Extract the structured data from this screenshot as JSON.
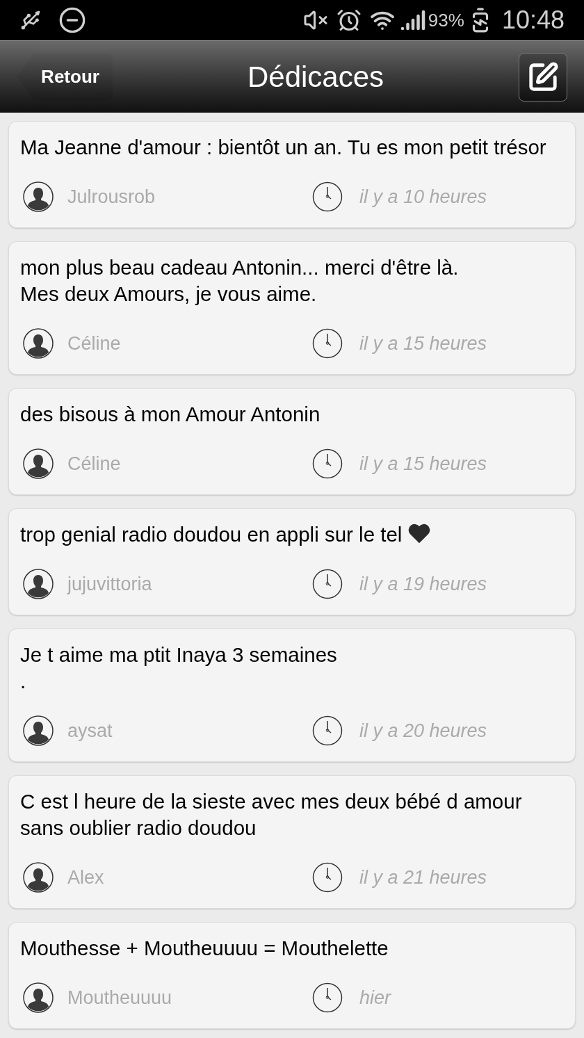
{
  "status_bar": {
    "battery": "93%",
    "time": "10:48"
  },
  "header": {
    "back": "Retour",
    "title": "Dédicaces"
  },
  "messages": [
    {
      "text": "Ma Jeanne d'amour : bientôt un an. Tu es mon petit trésor",
      "heart": false,
      "author": "Julrousrob",
      "time": "il y a 10 heures"
    },
    {
      "text": "mon plus beau cadeau Antonin... merci d'être là.\nMes deux Amours, je vous aime.",
      "heart": false,
      "author": "Céline",
      "time": "il y a 15 heures"
    },
    {
      "text": "des bisous à mon Amour Antonin",
      "heart": false,
      "author": "Céline",
      "time": "il y a 15 heures"
    },
    {
      "text": "trop genial radio doudou en appli sur le tel",
      "heart": true,
      "author": "jujuvittoria",
      "time": "il y a 19 heures"
    },
    {
      "text": "Je t aime ma ptit Inaya 3 semaines\n.",
      "heart": false,
      "author": "aysat",
      "time": "il y a 20 heures"
    },
    {
      "text": "C est l heure de la sieste avec mes deux bébé d amour sans oublier radio doudou",
      "heart": false,
      "author": "Alex",
      "time": "il y a 21 heures"
    },
    {
      "text": "Mouthesse + Moutheuuuu = Mouthelette",
      "heart": false,
      "author": "Moutheuuuu",
      "time": "hier"
    }
  ]
}
